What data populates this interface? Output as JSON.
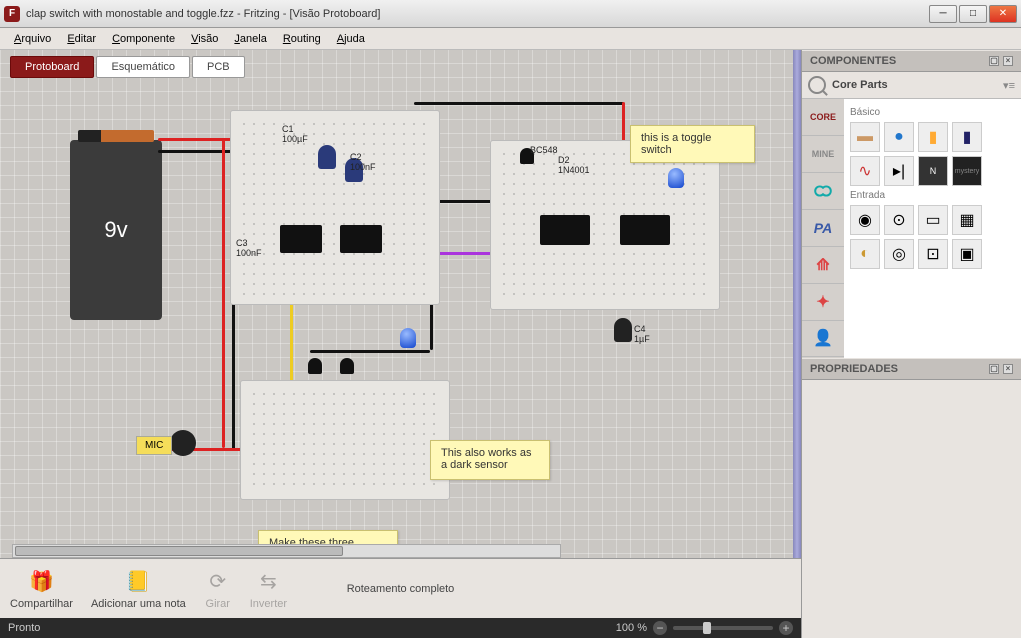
{
  "title": "clap switch with monostable and toggle.fzz - Fritzing - [Visão Protoboard]",
  "menu": [
    "Arquivo",
    "Editar",
    "Componente",
    "Visão",
    "Janela",
    "Routing",
    "Ajuda"
  ],
  "views": {
    "protoboard": "Protoboard",
    "schematic": "Esquemático",
    "pcb": "PCB"
  },
  "notes": {
    "toggle": "this is a toggle switch",
    "dark": "This also works as a dark sensor",
    "modules": "Make these three modules separately and combine them to"
  },
  "labels": {
    "battery": "9v",
    "c1": "C1\n100µF",
    "c2": "C2\n100nF",
    "c3": "C3\n100nF",
    "c4": "C4\n1µF",
    "bc": "BC548",
    "d2": "D2\n1N4001",
    "mic": "MIC"
  },
  "panels": {
    "components": "COMPONENTES",
    "coreparts": "Core Parts",
    "basic": "Básico",
    "input": "Entrada",
    "properties": "PROPRIEDADES"
  },
  "bins": {
    "core": "CORE",
    "mine": "MINE",
    "pa": "PA",
    "mystery": "mystery"
  },
  "tools": {
    "share": "Compartilhar",
    "note": "Adicionar uma nota",
    "rotate": "Girar",
    "flip": "Inverter"
  },
  "status": {
    "routing": "Roteamento completo",
    "ready": "Pronto",
    "zoom": "100 %"
  }
}
